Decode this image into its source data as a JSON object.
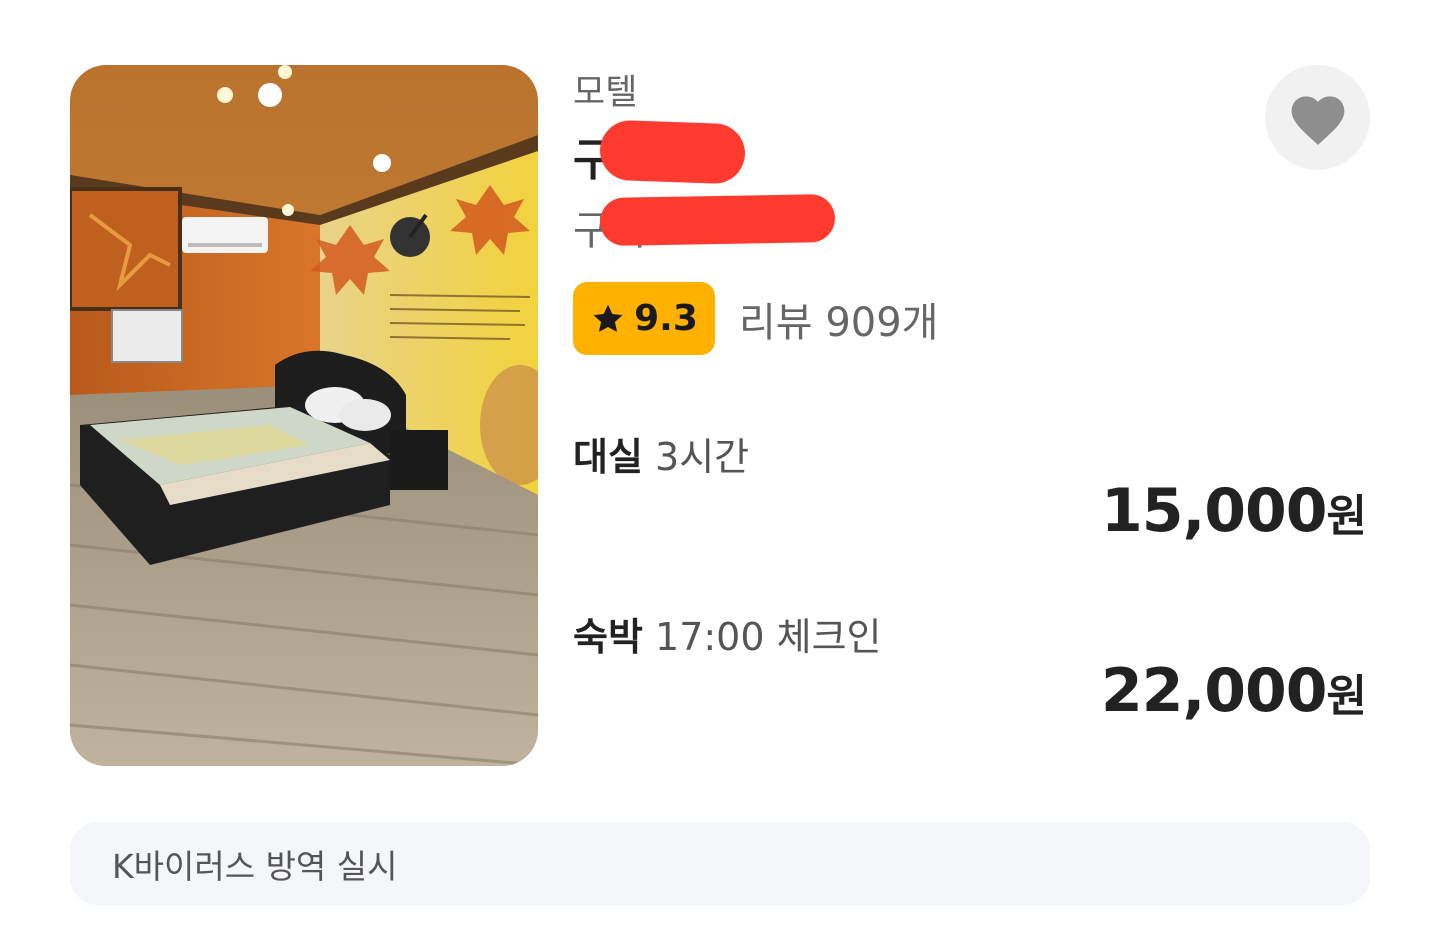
{
  "listing": {
    "category": "모텔",
    "name_visible": "구",
    "address_visible": "구미",
    "rating": "9.3",
    "review_label": "리뷰 909개"
  },
  "offers": [
    {
      "type": "대실",
      "detail": "3시간",
      "price": "15,000",
      "unit": "원"
    },
    {
      "type": "숙박",
      "detail": "17:00 체크인",
      "price": "22,000",
      "unit": "원"
    }
  ],
  "notice": "K바이러스 방역 실시",
  "icons": {
    "rating": "star-icon",
    "favorite": "heart-icon"
  },
  "colors": {
    "rating_badge": "#ffb100",
    "redaction": "#ff3b30",
    "favorite_icon": "#8e8e8e",
    "notice_bg": "#f5f6fa"
  }
}
